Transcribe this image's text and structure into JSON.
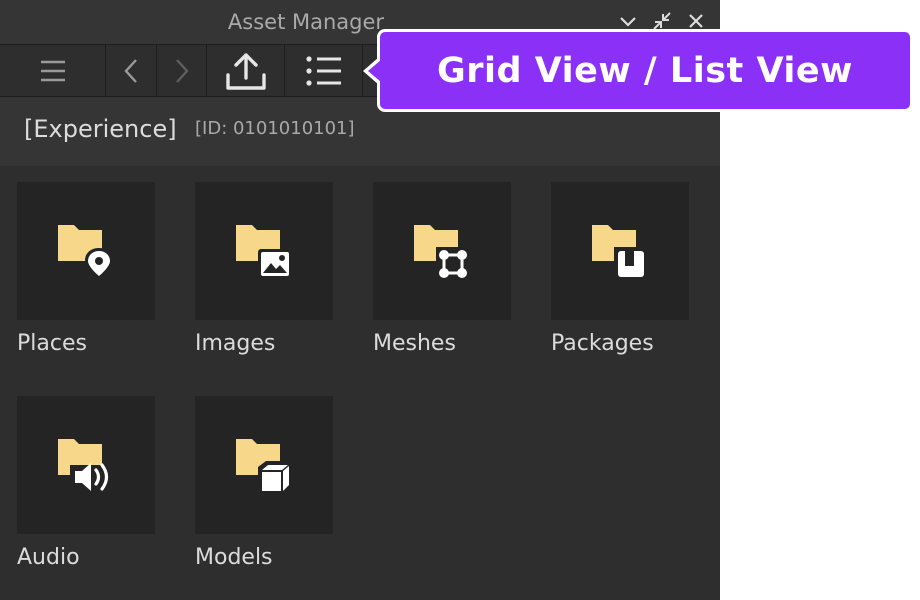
{
  "window": {
    "title": "Asset Manager",
    "controls": [
      "chevron-down-icon",
      "collapse-icon",
      "close-icon"
    ]
  },
  "toolbar": {
    "buttons": [
      {
        "icon": "hamburger-menu-icon"
      },
      {
        "icon": "chevron-left-icon"
      },
      {
        "icon": "chevron-right-icon"
      },
      {
        "icon": "upload-icon"
      },
      {
        "icon": "list-view-icon"
      }
    ]
  },
  "experience": {
    "name": "[Experience]",
    "id_label": "[ID: 0101010101]"
  },
  "folders": [
    {
      "label": "Places",
      "icon": "folder-location-pin-icon"
    },
    {
      "label": "Images",
      "icon": "folder-image-icon"
    },
    {
      "label": "Meshes",
      "icon": "folder-mesh-icon"
    },
    {
      "label": "Packages",
      "icon": "folder-package-icon"
    },
    {
      "label": "Audio",
      "icon": "folder-audio-icon"
    },
    {
      "label": "Models",
      "icon": "folder-model-icon"
    }
  ],
  "callout": {
    "text": "Grid View / List View"
  },
  "colors": {
    "panel_bg": "#2e2e2e",
    "tile_bg": "#242424",
    "folder_yellow": "#f7d88a",
    "callout_purple": "#8b30f7"
  }
}
